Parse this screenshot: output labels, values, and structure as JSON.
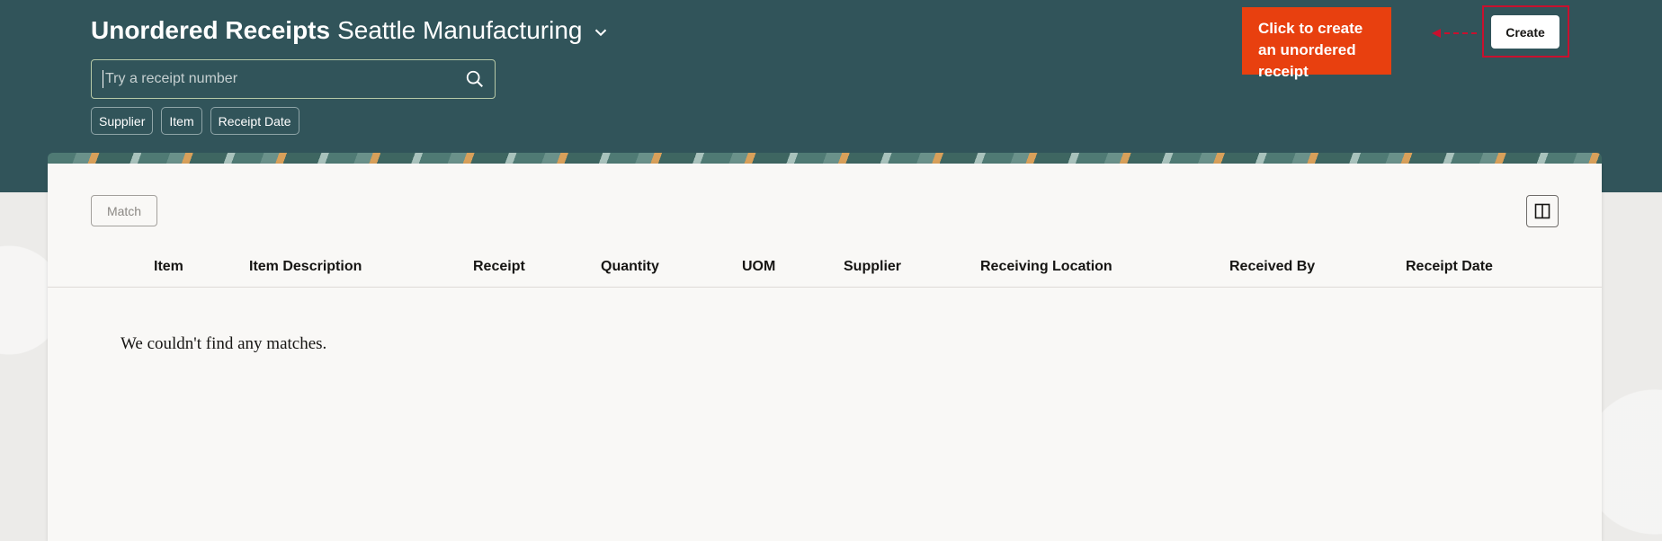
{
  "header": {
    "title": "Unordered Receipts",
    "subtitle": "Seattle Manufacturing",
    "search_placeholder": "Try a receipt number",
    "filter_chips": [
      "Supplier",
      "Item",
      "Receipt Date"
    ],
    "create_label": "Create"
  },
  "callout": {
    "text": "Click to create an unordered receipt",
    "color": "#e8400f",
    "highlight_color": "#c8102e"
  },
  "toolbar": {
    "match_label": "Match",
    "columns_icon": "split-view-icon"
  },
  "table": {
    "columns": [
      "Item",
      "Item Description",
      "Receipt",
      "Quantity",
      "UOM",
      "Supplier",
      "Receiving Location",
      "Received By",
      "Receipt Date"
    ],
    "rows": [],
    "empty_message": "We couldn't find any matches."
  },
  "colors": {
    "header_bg": "#31545a",
    "panel_bg": "#f9f8f6"
  }
}
